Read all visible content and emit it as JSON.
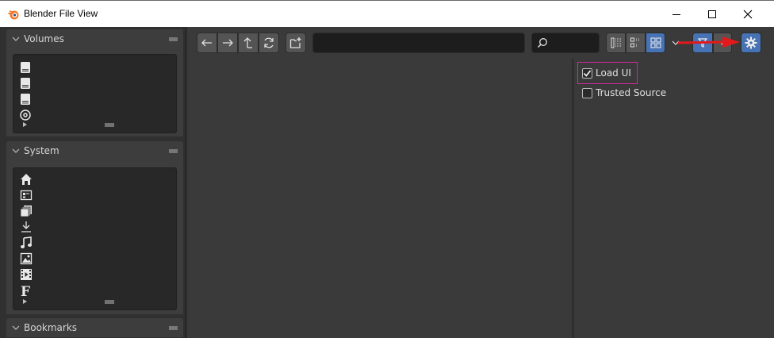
{
  "window": {
    "title": "Blender File View",
    "controls": {
      "minimize_icon": "minimize-icon",
      "maximize_icon": "maximize-icon",
      "close_icon": "close-icon"
    }
  },
  "sidebar": {
    "volumes": {
      "label": "Volumes",
      "items": [
        {
          "icon": "drive-icon"
        },
        {
          "icon": "drive-icon"
        },
        {
          "icon": "drive-icon"
        },
        {
          "icon": "disc-icon"
        }
      ]
    },
    "system": {
      "label": "System",
      "items": [
        {
          "icon": "home-icon"
        },
        {
          "icon": "desktop-icon"
        },
        {
          "icon": "documents-icon"
        },
        {
          "icon": "download-icon"
        },
        {
          "icon": "music-icon"
        },
        {
          "icon": "pictures-icon"
        },
        {
          "icon": "video-icon"
        },
        {
          "icon": "font-icon",
          "glyph": "F"
        }
      ]
    },
    "bookmarks": {
      "label": "Bookmarks"
    }
  },
  "toolbar": {
    "path_value": "",
    "search_value": "",
    "display_modes": [
      "vertical-list",
      "horizontal-list",
      "thumbnails"
    ],
    "active_display_mode": "thumbnails"
  },
  "options": {
    "load_ui": {
      "label": "Load UI",
      "checked": true
    },
    "trusted_source": {
      "label": "Trusted Source",
      "checked": false
    }
  },
  "colors": {
    "accent": "#4772b3",
    "highlight_box": "#d12a9b",
    "annotation_arrow": "#e3191c"
  }
}
